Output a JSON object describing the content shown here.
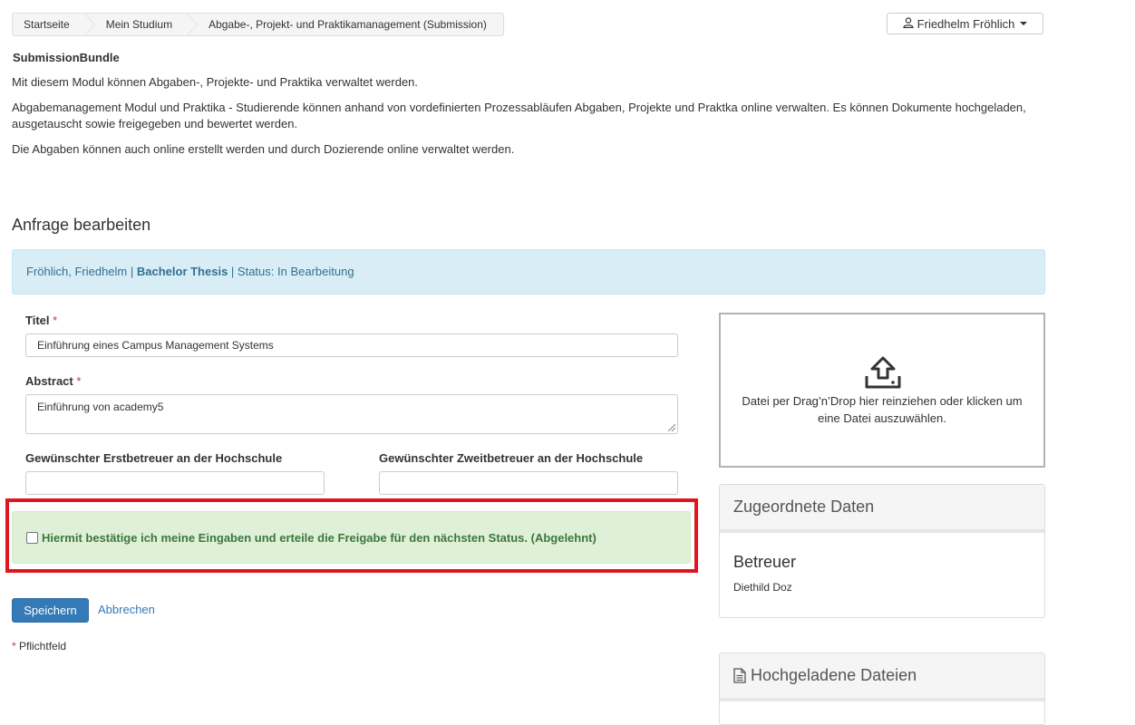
{
  "breadcrumb": [
    "Startseite",
    "Mein Studium",
    "Abgabe-, Projekt- und Praktikamanagement (Submission)"
  ],
  "user": {
    "name": "Friedhelm Fröhlich"
  },
  "module": {
    "title": "SubmissionBundle",
    "p1": "Mit diesem Modul können Abgaben-, Projekte- und Praktika verwaltet werden.",
    "p2": "Abgabemanagement Modul und Praktika  - Studierende können anhand von vordefinierten Prozessabläufen Abgaben, Projekte und Praktka online verwalten. Es können Dokumente hochgeladen, ausgetauscht sowie freigegeben und bewertet werden.",
    "p3": "Die Abgaben können auch online erstellt werden und durch Dozierende online verwaltet werden."
  },
  "section_title": "Anfrage bearbeiten",
  "info": {
    "name": "Fröhlich, Friedhelm",
    "sep": " | ",
    "type": "Bachelor Thesis",
    "status": "Status: In Bearbeitung"
  },
  "form": {
    "title_label": "Titel",
    "title_value": "Einführung eines Campus Management Systems",
    "abstract_label": "Abstract",
    "abstract_value": "Einführung von academy5",
    "advisor1_label": "Gewünschter Erstbetreuer an der Hochschule",
    "advisor1_value": "",
    "advisor2_label": "Gewünschter Zweitbetreuer an der Hochschule",
    "advisor2_value": "",
    "required_mark": "*",
    "confirm_text": "Hiermit bestätige ich meine Eingaben und erteile die Freigabe für den nächsten Status. (Abgelehnt)",
    "confirm_checked": false,
    "save_label": "Speichern",
    "cancel_label": "Abbrechen",
    "footnote": "Pflichtfeld"
  },
  "dropzone": {
    "text": "Datei per Drag’n’Drop hier reinziehen oder klicken um eine Datei auszuwählen.",
    "icon": "upload-icon"
  },
  "assigned": {
    "heading": "Zugeordnete Daten",
    "sub_title": "Betreuer",
    "value": "Diethild Doz"
  },
  "uploads": {
    "heading": "Hochgeladene Dateien",
    "icon": "file-icon"
  },
  "colors": {
    "primary": "#337ab7",
    "info_bg": "#d9edf7",
    "success_bg": "#dff0d8",
    "success_text": "#3c763d",
    "highlight_border": "#e0161f"
  }
}
